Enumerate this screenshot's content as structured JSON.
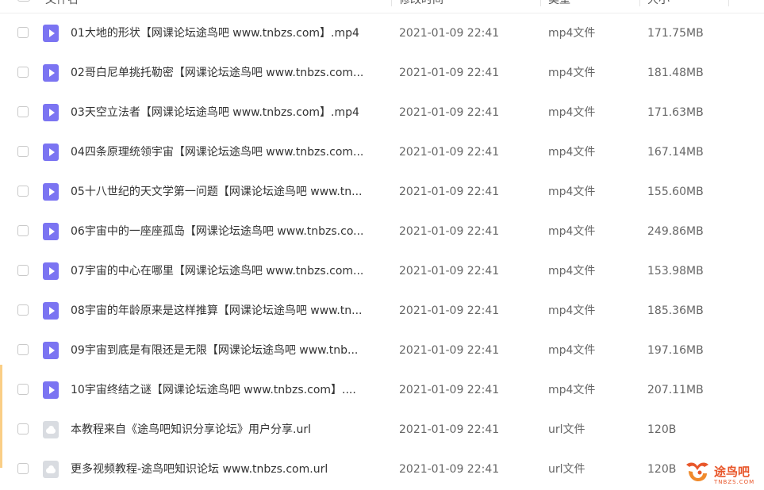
{
  "header": {
    "name_label": "文件名",
    "modified_label": "修改时间",
    "type_label": "类型",
    "size_label": "大小"
  },
  "files": [
    {
      "name": "01大地的形状【网课论坛途鸟吧 www.tnbzs.com】.mp4",
      "modified": "2021-01-09 22:41",
      "type": "mp4文件",
      "size": "171.75MB",
      "icon": "video-file-icon"
    },
    {
      "name": "02哥白尼单挑托勒密【网课论坛途鸟吧 www.tnbzs.com...",
      "modified": "2021-01-09 22:41",
      "type": "mp4文件",
      "size": "181.48MB",
      "icon": "video-file-icon"
    },
    {
      "name": "03天空立法者【网课论坛途鸟吧 www.tnbzs.com】.mp4",
      "modified": "2021-01-09 22:41",
      "type": "mp4文件",
      "size": "171.63MB",
      "icon": "video-file-icon"
    },
    {
      "name": "04四条原理统领宇宙【网课论坛途鸟吧 www.tnbzs.com...",
      "modified": "2021-01-09 22:41",
      "type": "mp4文件",
      "size": "167.14MB",
      "icon": "video-file-icon"
    },
    {
      "name": "05十八世纪的天文学第一问题【网课论坛途鸟吧 www.tn...",
      "modified": "2021-01-09 22:41",
      "type": "mp4文件",
      "size": "155.60MB",
      "icon": "video-file-icon"
    },
    {
      "name": "06宇宙中的一座座孤岛【网课论坛途鸟吧 www.tnbzs.co...",
      "modified": "2021-01-09 22:41",
      "type": "mp4文件",
      "size": "249.86MB",
      "icon": "video-file-icon"
    },
    {
      "name": "07宇宙的中心在哪里【网课论坛途鸟吧 www.tnbzs.com...",
      "modified": "2021-01-09 22:41",
      "type": "mp4文件",
      "size": "153.98MB",
      "icon": "video-file-icon"
    },
    {
      "name": "08宇宙的年龄原来是这样推算【网课论坛途鸟吧 www.tn...",
      "modified": "2021-01-09 22:41",
      "type": "mp4文件",
      "size": "185.36MB",
      "icon": "video-file-icon"
    },
    {
      "name": "09宇宙到底是有限还是无限【网课论坛途鸟吧 www.tnb...",
      "modified": "2021-01-09 22:41",
      "type": "mp4文件",
      "size": "197.16MB",
      "icon": "video-file-icon"
    },
    {
      "name": "10宇宙终结之谜【网课论坛途鸟吧 www.tnbzs.com】....",
      "modified": "2021-01-09 22:41",
      "type": "mp4文件",
      "size": "207.11MB",
      "icon": "video-file-icon"
    },
    {
      "name": "本教程来自《途鸟吧知识分享论坛》用户分享.url",
      "modified": "2021-01-09 22:41",
      "type": "url文件",
      "size": "120B",
      "icon": "url-file-icon"
    },
    {
      "name": "更多视频教程-途鸟吧知识论坛 www.tnbzs.com.url",
      "modified": "2021-01-09 22:41",
      "type": "url文件",
      "size": "120B",
      "icon": "url-file-icon"
    }
  ],
  "watermark": {
    "text": "途鸟吧",
    "sub": "TNBZS.COM",
    "color": "#e8562a"
  },
  "colors": {
    "video_icon": "#7b74f2",
    "url_icon": "#d9dce1",
    "sort_accent": "#4aa3f0"
  }
}
